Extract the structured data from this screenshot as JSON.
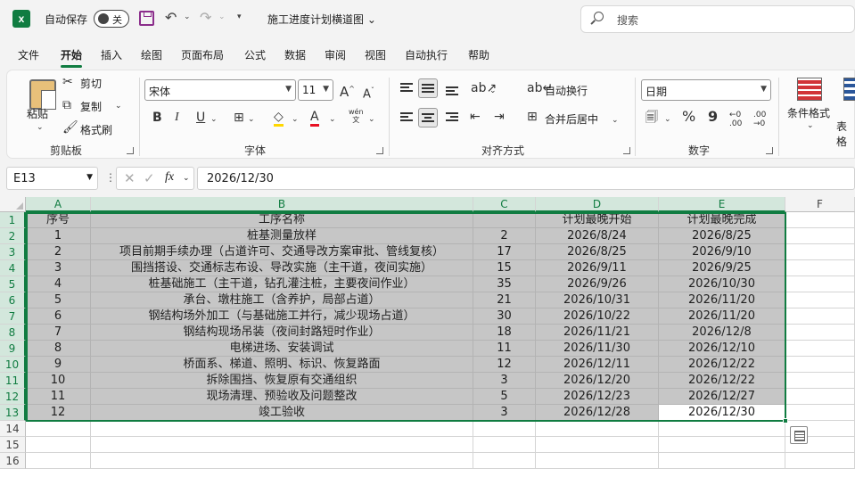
{
  "titlebar": {
    "autosave_label": "自动保存",
    "autosave_state": "关",
    "doc_title": "施工进度计划横道图",
    "search_placeholder": "搜索"
  },
  "menu": [
    "文件",
    "开始",
    "插入",
    "绘图",
    "页面布局",
    "公式",
    "数据",
    "审阅",
    "视图",
    "自动执行",
    "帮助"
  ],
  "active_menu": "开始",
  "ribbon": {
    "clipboard": {
      "paste": "粘贴",
      "cut": "剪切",
      "copy": "复制",
      "format_painter": "格式刷",
      "label": "剪贴板"
    },
    "font": {
      "name": "宋体",
      "size": "11",
      "label": "字体",
      "grow": "A",
      "shrink": "A",
      "phonetic": "wén\n文"
    },
    "alignment": {
      "wrap": "自动换行",
      "merge": "合并后居中",
      "label": "对齐方式"
    },
    "number": {
      "format": "日期",
      "percent": "%",
      "comma": "9",
      "label": "数字"
    },
    "styles": {
      "conditional": "条件格式",
      "table_partial": "表格"
    }
  },
  "formula_bar": {
    "cell_ref": "E13",
    "fx": "fx",
    "value": "2026/12/30"
  },
  "columns": [
    "A",
    "B",
    "C",
    "D",
    "E",
    "F"
  ],
  "row_numbers": [
    "1",
    "2",
    "3",
    "4",
    "5",
    "6",
    "7",
    "8",
    "9",
    "10",
    "11",
    "12",
    "13",
    "14",
    "15",
    "16"
  ],
  "table": {
    "headers": [
      "序号",
      "工序名称",
      "",
      "计划最晚开始",
      "计划最晚完成"
    ],
    "rows": [
      [
        "1",
        "桩基测量放样",
        "2",
        "2026/8/24",
        "2026/8/25"
      ],
      [
        "2",
        "项目前期手续办理（占道许可、交通导改方案审批、管线复核）",
        "17",
        "2026/8/25",
        "2026/9/10"
      ],
      [
        "3",
        "围挡搭设、交通标志布设、导改实施（主干道，夜间实施）",
        "15",
        "2026/9/11",
        "2026/9/25"
      ],
      [
        "4",
        "桩基础施工（主干道，钻孔灌注桩，主要夜间作业）",
        "35",
        "2026/9/26",
        "2026/10/30"
      ],
      [
        "5",
        "承台、墩柱施工（含养护，局部占道）",
        "21",
        "2026/10/31",
        "2026/11/20"
      ],
      [
        "6",
        "钢结构场外加工（与基础施工并行，减少现场占道）",
        "30",
        "2026/10/22",
        "2026/11/20"
      ],
      [
        "7",
        "钢结构现场吊装（夜间封路短时作业）",
        "18",
        "2026/11/21",
        "2026/12/8"
      ],
      [
        "8",
        "电梯进场、安装调试",
        "11",
        "2026/11/30",
        "2026/12/10"
      ],
      [
        "9",
        "桥面系、梯道、照明、标识、恢复路面",
        "12",
        "2026/12/11",
        "2026/12/22"
      ],
      [
        "10",
        "拆除围挡、恢复原有交通组织",
        "3",
        "2026/12/20",
        "2026/12/22"
      ],
      [
        "11",
        "现场清理、预验收及问题整改",
        "5",
        "2026/12/23",
        "2026/12/27"
      ],
      [
        "12",
        "竣工验收",
        "3",
        "2026/12/28",
        "2026/12/30"
      ]
    ]
  },
  "colors": {
    "accent": "#107c41",
    "selection_fill": "#c6c6c6"
  }
}
